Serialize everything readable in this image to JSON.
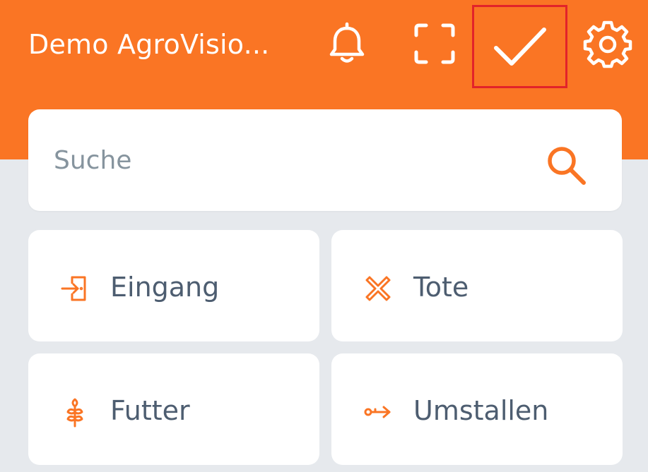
{
  "header": {
    "title": "Demo AgroVisio...",
    "background_color": "#fa7524",
    "icons": {
      "bell": "bell-icon",
      "scan": "scan-frame-icon",
      "check": "checkmark-icon",
      "settings": "gear-icon"
    },
    "highlight_color": "#e2232a"
  },
  "search": {
    "placeholder": "Suche",
    "icon": "search-icon"
  },
  "tiles": [
    {
      "label": "Eingang",
      "icon": "entrance-icon"
    },
    {
      "label": "Tote",
      "icon": "cross-icon"
    },
    {
      "label": "Futter",
      "icon": "wheat-icon"
    },
    {
      "label": "Umstallen",
      "icon": "transfer-arrow-icon"
    }
  ],
  "colors": {
    "accent": "#fa7524",
    "background": "#e6e9ed",
    "tile_text": "#4d5d70",
    "placeholder": "#86949e"
  }
}
